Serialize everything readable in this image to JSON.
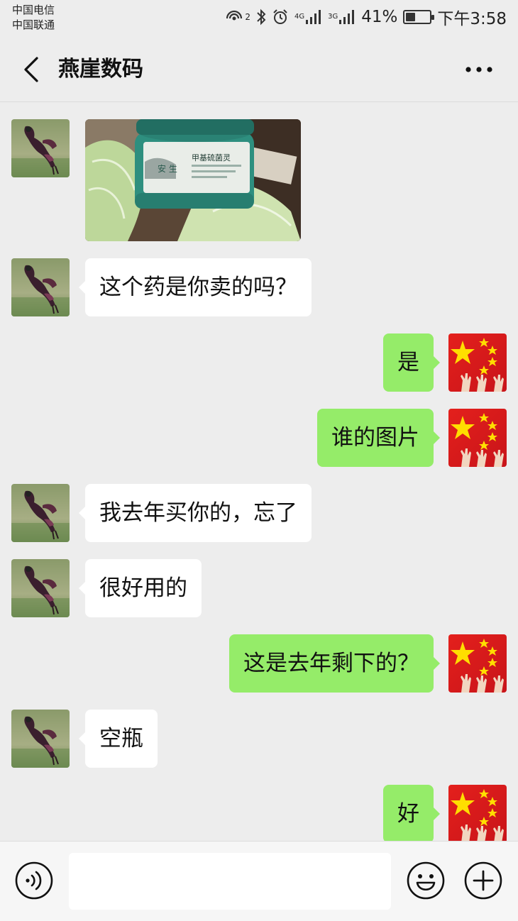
{
  "status_bar": {
    "carrier_1": "中国电信",
    "carrier_2": "中国联通",
    "hotspot_sup": "2",
    "net_1": "4G",
    "net_2": "3G",
    "battery": "41%",
    "battery_level": 0.41,
    "time": "下午3:58"
  },
  "header": {
    "title": "燕崖数码",
    "back_icon": "chevron-left-icon",
    "more_icon": "ellipsis-icon"
  },
  "messages": [
    {
      "side": "left",
      "type": "image",
      "text": ""
    },
    {
      "side": "left",
      "type": "text",
      "text": "这个药是你卖的吗？"
    },
    {
      "side": "right",
      "type": "text",
      "text": "是"
    },
    {
      "side": "right",
      "type": "text",
      "text": "谁的图片"
    },
    {
      "side": "left",
      "type": "text",
      "text": "我去年买你的，忘了"
    },
    {
      "side": "left",
      "type": "text",
      "text": "很好用的"
    },
    {
      "side": "right",
      "type": "text",
      "text": "这是去年剩下的？"
    },
    {
      "side": "left",
      "type": "text",
      "text": "空瓶"
    },
    {
      "side": "right",
      "type": "text",
      "text": "好"
    }
  ],
  "photo": {
    "label_brand": "安 生",
    "label_product": "甲基硫菌灵"
  },
  "input_bar": {
    "value": "",
    "voice_icon": "voice-icon",
    "emoji_icon": "emoji-icon",
    "plus_icon": "plus-circle-icon"
  },
  "colors": {
    "background": "#ededed",
    "self_bubble": "#95ec69",
    "other_bubble": "#ffffff"
  }
}
